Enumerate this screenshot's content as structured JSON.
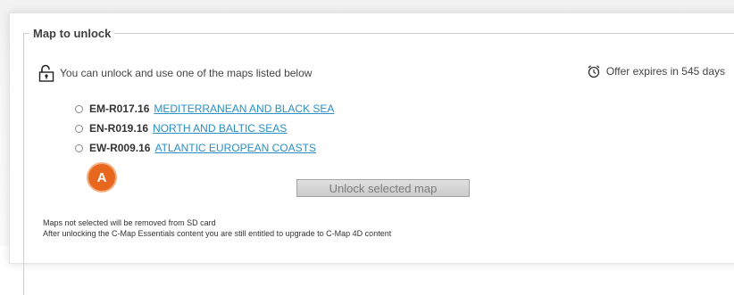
{
  "section": {
    "legend": "Map to unlock",
    "info_text": "You can unlock and use one of the maps listed below",
    "expiry_text": "Offer expires in 545 days"
  },
  "maps": [
    {
      "code": "EM-R017.16",
      "name": "MEDITERRANEAN AND BLACK SEA"
    },
    {
      "code": "EN-R019.16",
      "name": "NORTH AND BALTIC SEAS"
    },
    {
      "code": "EW-R009.16",
      "name": "ATLANTIC EUROPEAN COASTS"
    }
  ],
  "callout": {
    "label": "A",
    "color": "#e8671e"
  },
  "unlock_button": {
    "label": "Unlock selected map"
  },
  "notes": [
    "Maps not selected will be removed from SD card",
    "After unlocking the C-Map Essentials content you are still entitled to upgrade to C-Map 4D content"
  ],
  "colors": {
    "link": "#2a8fc2",
    "button_text": "#7a7a7a"
  }
}
